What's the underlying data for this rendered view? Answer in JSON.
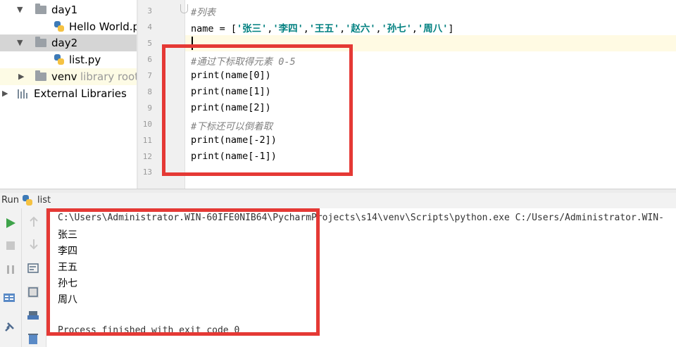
{
  "project_tree": {
    "items": [
      {
        "label": "day1",
        "type": "folder"
      },
      {
        "label": "Hello World.py",
        "type": "file"
      },
      {
        "label": "day2",
        "type": "folder"
      },
      {
        "label": "list.py",
        "type": "file"
      },
      {
        "label": "venv",
        "type": "folder",
        "suffix": "library root"
      },
      {
        "label": "External Libraries",
        "type": "libraries"
      }
    ]
  },
  "editor": {
    "lines": [
      {
        "num": "3",
        "text": "#列表"
      },
      {
        "num": "4",
        "prefix": "name = [",
        "strings": [
          "'张三'",
          "'李四'",
          "'王五'",
          "'赵六'",
          "'孙七'",
          "'周八'"
        ],
        "suffix": "]"
      },
      {
        "num": "5",
        "text": ""
      },
      {
        "num": "6",
        "text": "#通过下标取得元素 0-5"
      },
      {
        "num": "7",
        "text": "print(name[0])"
      },
      {
        "num": "8",
        "text": "print(name[1])"
      },
      {
        "num": "9",
        "text": "print(name[2])"
      },
      {
        "num": "10",
        "text": "#下标还可以倒着取"
      },
      {
        "num": "11",
        "text": "print(name[-2])"
      },
      {
        "num": "12",
        "text": "print(name[-1])"
      },
      {
        "num": "13",
        "text": ""
      }
    ]
  },
  "run_panel": {
    "title": "Run",
    "config": "list",
    "command": "C:\\Users\\Administrator.WIN-60IFE0NIB64\\PycharmProjects\\s14\\venv\\Scripts\\python.exe C:/Users/Administrator.WIN-",
    "output": [
      "张三",
      "李四",
      "王五",
      "孙七",
      "周八"
    ],
    "exit_message": "Process finished with exit code 0"
  },
  "colors": {
    "highlight_box": "#e53935",
    "selected_row": "#d5d5d5",
    "string_color": "#008080",
    "comment_color": "#808080"
  }
}
